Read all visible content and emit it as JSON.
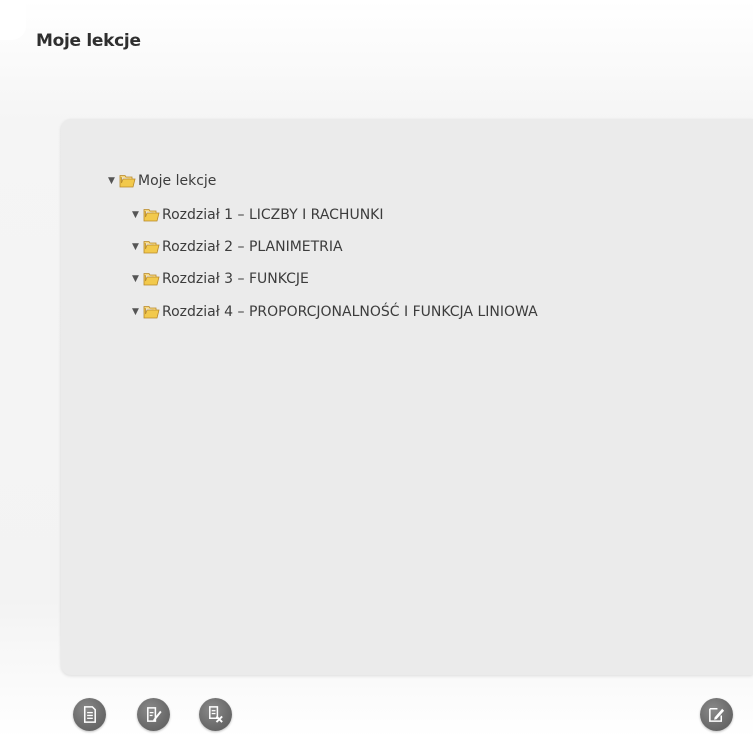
{
  "page": {
    "title": "Moje lekcje"
  },
  "tree": {
    "root": {
      "label": "Moje lekcje",
      "expanded": true
    },
    "children": [
      {
        "label": "Rozdział 1 – LICZBY I RACHUNKI",
        "expanded": true
      },
      {
        "label": "Rozdział 2 – PLANIMETRIA",
        "expanded": true
      },
      {
        "label": "Rozdział 3 – FUNKCJE",
        "expanded": true
      },
      {
        "label": "Rozdział 4 – PROPORCJONALNOŚĆ I FUNKCJA LINIOWA",
        "expanded": true
      }
    ]
  },
  "icons": {
    "expand": "triangle-down-icon",
    "folder": "folder-icon",
    "folder_color": "#f2c94c"
  },
  "toolbar": {
    "buttons": [
      {
        "icon": "document-icon"
      },
      {
        "icon": "edit-document-icon"
      },
      {
        "icon": "delete-document-icon"
      },
      {
        "icon": "edit-icon"
      }
    ],
    "button_color": "#6d6d6d"
  }
}
